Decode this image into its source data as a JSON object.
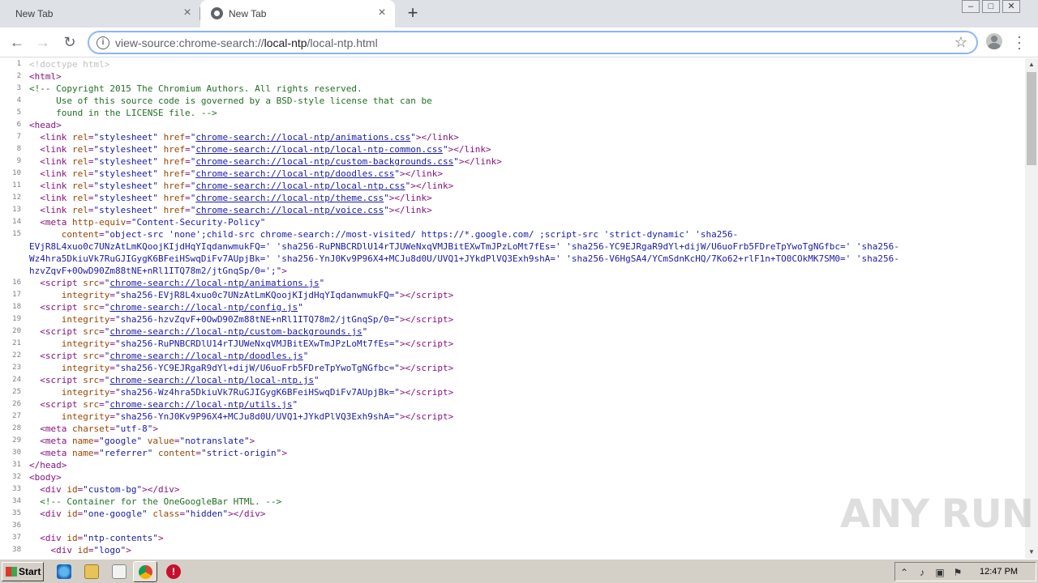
{
  "tabs": [
    {
      "title": "New Tab"
    },
    {
      "title": "New Tab"
    }
  ],
  "toolbar": {
    "url_scheme": "view-source:chrome-search://",
    "url_host": "local-ntp",
    "url_path": "/local-ntp.html"
  },
  "source_lines": [
    {
      "n": "1",
      "html": "<span class=\"doct\">&lt;!doctype html&gt;</span>"
    },
    {
      "n": "2",
      "html": "<span class=\"tag\">&lt;html&gt;</span>"
    },
    {
      "n": "3",
      "html": "<span class=\"cmt\">&lt;!-- Copyright 2015 The Chromium Authors. All rights reserved.</span>"
    },
    {
      "n": "4",
      "html": "<span class=\"cmt\">     Use of this source code is governed by a BSD-style license that can be</span>"
    },
    {
      "n": "5",
      "html": "<span class=\"cmt\">     found in the LICENSE file. --&gt;</span>"
    },
    {
      "n": "6",
      "html": "<span class=\"tag\">&lt;head&gt;</span>"
    },
    {
      "n": "7",
      "html": "  <span class=\"tag\">&lt;link </span><span class=\"attr\">rel</span><span class=\"tag\">=</span><span class=\"val\">\"stylesheet\"</span> <span class=\"attr\">href</span><span class=\"tag\">=</span><span class=\"val\">\"</span><span class=\"lnk\">chrome-search://local-ntp/animations.css</span><span class=\"val\">\"</span><span class=\"tag\">&gt;&lt;/link&gt;</span>"
    },
    {
      "n": "8",
      "html": "  <span class=\"tag\">&lt;link </span><span class=\"attr\">rel</span><span class=\"tag\">=</span><span class=\"val\">\"stylesheet\"</span> <span class=\"attr\">href</span><span class=\"tag\">=</span><span class=\"val\">\"</span><span class=\"lnk\">chrome-search://local-ntp/local-ntp-common.css</span><span class=\"val\">\"</span><span class=\"tag\">&gt;&lt;/link&gt;</span>"
    },
    {
      "n": "9",
      "html": "  <span class=\"tag\">&lt;link </span><span class=\"attr\">rel</span><span class=\"tag\">=</span><span class=\"val\">\"stylesheet\"</span> <span class=\"attr\">href</span><span class=\"tag\">=</span><span class=\"val\">\"</span><span class=\"lnk\">chrome-search://local-ntp/custom-backgrounds.css</span><span class=\"val\">\"</span><span class=\"tag\">&gt;&lt;/link&gt;</span>"
    },
    {
      "n": "10",
      "html": "  <span class=\"tag\">&lt;link </span><span class=\"attr\">rel</span><span class=\"tag\">=</span><span class=\"val\">\"stylesheet\"</span> <span class=\"attr\">href</span><span class=\"tag\">=</span><span class=\"val\">\"</span><span class=\"lnk\">chrome-search://local-ntp/doodles.css</span><span class=\"val\">\"</span><span class=\"tag\">&gt;&lt;/link&gt;</span>"
    },
    {
      "n": "11",
      "html": "  <span class=\"tag\">&lt;link </span><span class=\"attr\">rel</span><span class=\"tag\">=</span><span class=\"val\">\"stylesheet\"</span> <span class=\"attr\">href</span><span class=\"tag\">=</span><span class=\"val\">\"</span><span class=\"lnk\">chrome-search://local-ntp/local-ntp.css</span><span class=\"val\">\"</span><span class=\"tag\">&gt;&lt;/link&gt;</span>"
    },
    {
      "n": "12",
      "html": "  <span class=\"tag\">&lt;link </span><span class=\"attr\">rel</span><span class=\"tag\">=</span><span class=\"val\">\"stylesheet\"</span> <span class=\"attr\">href</span><span class=\"tag\">=</span><span class=\"val\">\"</span><span class=\"lnk\">chrome-search://local-ntp/theme.css</span><span class=\"val\">\"</span><span class=\"tag\">&gt;&lt;/link&gt;</span>"
    },
    {
      "n": "13",
      "html": "  <span class=\"tag\">&lt;link </span><span class=\"attr\">rel</span><span class=\"tag\">=</span><span class=\"val\">\"stylesheet\"</span> <span class=\"attr\">href</span><span class=\"tag\">=</span><span class=\"val\">\"</span><span class=\"lnk\">chrome-search://local-ntp/voice.css</span><span class=\"val\">\"</span><span class=\"tag\">&gt;&lt;/link&gt;</span>"
    },
    {
      "n": "14",
      "html": "  <span class=\"tag\">&lt;meta </span><span class=\"attr\">http-equiv</span><span class=\"tag\">=</span><span class=\"val\">\"Content-Security-Policy\"</span>"
    },
    {
      "n": "15",
      "html": "      <span class=\"attr\">content</span><span class=\"tag\">=</span><span class=\"val\">\"object-src 'none';child-src chrome-search://most-visited/ https://*.google.com/ ;script-src 'strict-dynamic' 'sha256-</span>"
    },
    {
      "n": "",
      "html": "<span class=\"val\">EVjR8L4xuo0c7UNzAtLmKQoojKIjdHqYIqdanwmukFQ=' 'sha256-RuPNBCRDlU14rTJUWeNxqVMJBitEXwTmJPzLoMt7fEs=' 'sha256-YC9EJRgaR9dYl+dijW/U6uoFrb5FDreTpYwoTgNGfbc=' 'sha256-</span>"
    },
    {
      "n": "",
      "html": "<span class=\"val\">Wz4hra5DkiuVk7RuGJIGygK6BFeiHSwqDiFv7AUpjBk=' 'sha256-YnJ0Kv9P96X4+MCJu8d0U/UVQ1+JYkdPlVQ3Exh9shA=' 'sha256-V6HgSA4/YCmSdnKcHQ/7Ko62+rlF1n+TO0COkMK7SM0=' 'sha256-</span>"
    },
    {
      "n": "",
      "html": "<span class=\"val\">hzvZqvF+0OwD90Zm88tNE+nRl1ITQ78m2/jtGnqSp/0=';\"</span><span class=\"tag\">&gt;</span>"
    },
    {
      "n": "16",
      "html": "  <span class=\"tag\">&lt;script </span><span class=\"attr\">src</span><span class=\"tag\">=</span><span class=\"val\">\"</span><span class=\"lnk\">chrome-search://local-ntp/animations.js</span><span class=\"val\">\"</span>"
    },
    {
      "n": "17",
      "html": "      <span class=\"attr\">integrity</span><span class=\"tag\">=</span><span class=\"val\">\"sha256-EVjR8L4xuo0c7UNzAtLmKQoojKIjdHqYIqdanwmukFQ=\"</span><span class=\"tag\">&gt;&lt;/script&gt;</span>"
    },
    {
      "n": "18",
      "html": "  <span class=\"tag\">&lt;script </span><span class=\"attr\">src</span><span class=\"tag\">=</span><span class=\"val\">\"</span><span class=\"lnk\">chrome-search://local-ntp/config.js</span><span class=\"val\">\"</span>"
    },
    {
      "n": "19",
      "html": "      <span class=\"attr\">integrity</span><span class=\"tag\">=</span><span class=\"val\">\"sha256-hzvZqvF+0OwD90Zm88tNE+nRl1ITQ78m2/jtGnqSp/0=\"</span><span class=\"tag\">&gt;&lt;/script&gt;</span>"
    },
    {
      "n": "20",
      "html": "  <span class=\"tag\">&lt;script </span><span class=\"attr\">src</span><span class=\"tag\">=</span><span class=\"val\">\"</span><span class=\"lnk\">chrome-search://local-ntp/custom-backgrounds.js</span><span class=\"val\">\"</span>"
    },
    {
      "n": "21",
      "html": "      <span class=\"attr\">integrity</span><span class=\"tag\">=</span><span class=\"val\">\"sha256-RuPNBCRDlU14rTJUWeNxqVMJBitEXwTmJPzLoMt7fEs=\"</span><span class=\"tag\">&gt;&lt;/script&gt;</span>"
    },
    {
      "n": "22",
      "html": "  <span class=\"tag\">&lt;script </span><span class=\"attr\">src</span><span class=\"tag\">=</span><span class=\"val\">\"</span><span class=\"lnk\">chrome-search://local-ntp/doodles.js</span><span class=\"val\">\"</span>"
    },
    {
      "n": "23",
      "html": "      <span class=\"attr\">integrity</span><span class=\"tag\">=</span><span class=\"val\">\"sha256-YC9EJRgaR9dYl+dijW/U6uoFrb5FDreTpYwoTgNGfbc=\"</span><span class=\"tag\">&gt;&lt;/script&gt;</span>"
    },
    {
      "n": "24",
      "html": "  <span class=\"tag\">&lt;script </span><span class=\"attr\">src</span><span class=\"tag\">=</span><span class=\"val\">\"</span><span class=\"lnk\">chrome-search://local-ntp/local-ntp.js</span><span class=\"val\">\"</span>"
    },
    {
      "n": "25",
      "html": "      <span class=\"attr\">integrity</span><span class=\"tag\">=</span><span class=\"val\">\"sha256-Wz4hra5DkiuVk7RuGJIGygK6BFeiHSwqDiFv7AUpjBk=\"</span><span class=\"tag\">&gt;&lt;/script&gt;</span>"
    },
    {
      "n": "26",
      "html": "  <span class=\"tag\">&lt;script </span><span class=\"attr\">src</span><span class=\"tag\">=</span><span class=\"val\">\"</span><span class=\"lnk\">chrome-search://local-ntp/utils.js</span><span class=\"val\">\"</span>"
    },
    {
      "n": "27",
      "html": "      <span class=\"attr\">integrity</span><span class=\"tag\">=</span><span class=\"val\">\"sha256-YnJ0Kv9P96X4+MCJu8d0U/UVQ1+JYkdPlVQ3Exh9shA=\"</span><span class=\"tag\">&gt;&lt;/script&gt;</span>"
    },
    {
      "n": "28",
      "html": "  <span class=\"tag\">&lt;meta </span><span class=\"attr\">charset</span><span class=\"tag\">=</span><span class=\"val\">\"utf-8\"</span><span class=\"tag\">&gt;</span>"
    },
    {
      "n": "29",
      "html": "  <span class=\"tag\">&lt;meta </span><span class=\"attr\">name</span><span class=\"tag\">=</span><span class=\"val\">\"google\"</span> <span class=\"attr\">value</span><span class=\"tag\">=</span><span class=\"val\">\"notranslate\"</span><span class=\"tag\">&gt;</span>"
    },
    {
      "n": "30",
      "html": "  <span class=\"tag\">&lt;meta </span><span class=\"attr\">name</span><span class=\"tag\">=</span><span class=\"val\">\"referrer\"</span> <span class=\"attr\">content</span><span class=\"tag\">=</span><span class=\"val\">\"strict-origin\"</span><span class=\"tag\">&gt;</span>"
    },
    {
      "n": "31",
      "html": "<span class=\"tag\">&lt;/head&gt;</span>"
    },
    {
      "n": "32",
      "html": "<span class=\"tag\">&lt;body&gt;</span>"
    },
    {
      "n": "33",
      "html": "  <span class=\"tag\">&lt;div </span><span class=\"attr\">id</span><span class=\"tag\">=</span><span class=\"val\">\"custom-bg\"</span><span class=\"tag\">&gt;&lt;/div&gt;</span>"
    },
    {
      "n": "34",
      "html": "  <span class=\"cmt\">&lt;!-- Container for the OneGoogleBar HTML. --&gt;</span>"
    },
    {
      "n": "35",
      "html": "  <span class=\"tag\">&lt;div </span><span class=\"attr\">id</span><span class=\"tag\">=</span><span class=\"val\">\"one-google\"</span> <span class=\"attr\">class</span><span class=\"tag\">=</span><span class=\"val\">\"hidden\"</span><span class=\"tag\">&gt;&lt;/div&gt;</span>"
    },
    {
      "n": "36",
      "html": ""
    },
    {
      "n": "37",
      "html": "  <span class=\"tag\">&lt;div </span><span class=\"attr\">id</span><span class=\"tag\">=</span><span class=\"val\">\"ntp-contents\"</span><span class=\"tag\">&gt;</span>"
    },
    {
      "n": "38",
      "html": "    <span class=\"tag\">&lt;div </span><span class=\"attr\">id</span><span class=\"tag\">=</span><span class=\"val\">\"logo\"</span><span class=\"tag\">&gt;</span>"
    }
  ],
  "taskbar": {
    "start_label": "Start",
    "clock": "12:47 PM"
  },
  "watermark": "ANY RUN"
}
